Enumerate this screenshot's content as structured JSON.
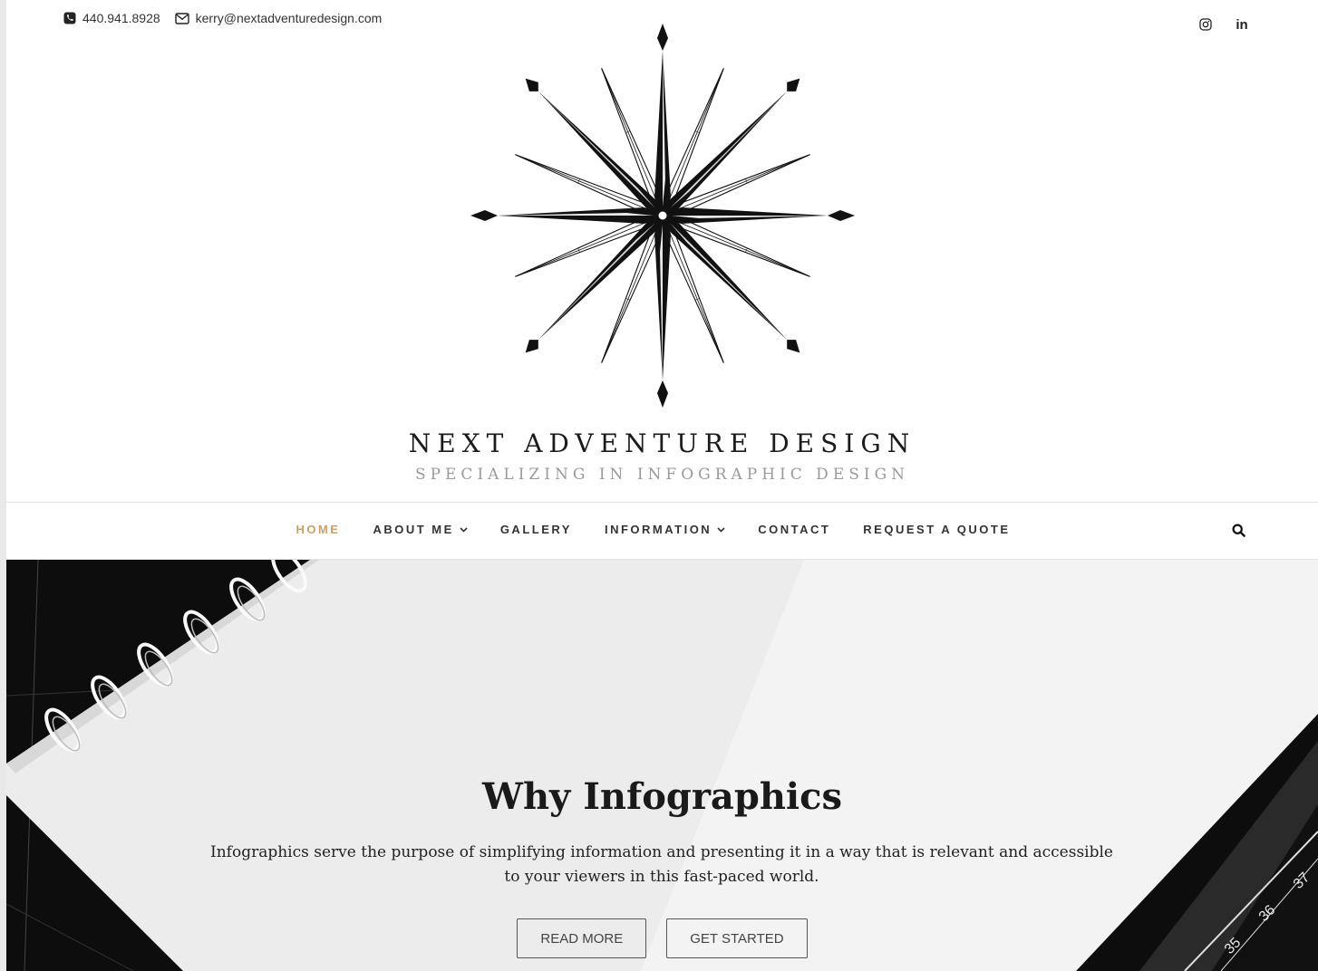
{
  "topbar": {
    "phone": "440.941.8928",
    "email": "kerry@nextadventuredesign.com",
    "social": [
      {
        "name": "instagram",
        "icon": "instagram-icon"
      },
      {
        "name": "linkedin",
        "icon": "linkedin-icon",
        "label": "in"
      }
    ]
  },
  "brand": {
    "name": "NEXT ADVENTURE DESIGN",
    "tagline": "SPECIALIZING IN INFOGRAPHIC DESIGN",
    "logo_icon": "compass-rose-icon"
  },
  "nav": {
    "items": [
      {
        "label": "HOME",
        "active": true,
        "dropdown": false
      },
      {
        "label": "ABOUT ME",
        "active": false,
        "dropdown": true
      },
      {
        "label": "GALLERY",
        "active": false,
        "dropdown": false
      },
      {
        "label": "INFORMATION",
        "active": false,
        "dropdown": true
      },
      {
        "label": "CONTACT",
        "active": false,
        "dropdown": false
      },
      {
        "label": "REQUEST A QUOTE",
        "active": false,
        "dropdown": false
      }
    ],
    "search_icon": "search-icon"
  },
  "hero": {
    "title": "Why Infographics",
    "text": "Infographics serve the purpose of simplifying information and presenting it in a way that is relevant and accessible to your viewers in this fast-paced world.",
    "buttons": {
      "read_more": "READ MORE",
      "get_started": "GET STARTED"
    },
    "ruler_numbers": [
      "35",
      "36",
      "37"
    ]
  },
  "colors": {
    "accent": "#c8a16a",
    "text": "#222222",
    "tagline": "#9a9a9a",
    "nav_border": "#e3e3e3"
  }
}
